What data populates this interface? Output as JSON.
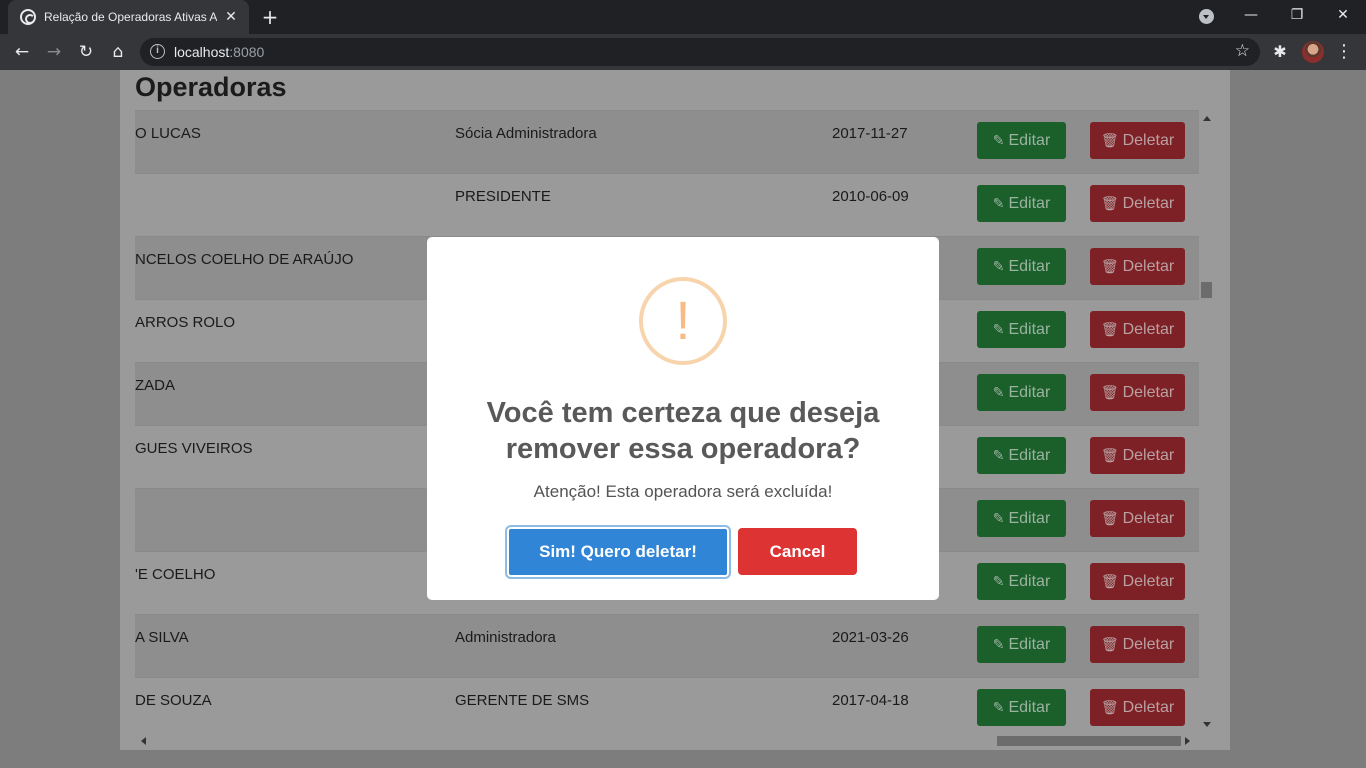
{
  "browser": {
    "tab_title": "Relação de Operadoras Ativas AN",
    "url_host": "localhost",
    "url_port": ":8080"
  },
  "page": {
    "title": "Operadoras",
    "edit_label": "Editar",
    "delete_label": "Deletar",
    "rows": [
      {
        "name": "O LUCAS",
        "role": "Sócia Administradora",
        "date": "2017-11-27"
      },
      {
        "name": "",
        "role": "PRESIDENTE",
        "date": "2010-06-09"
      },
      {
        "name": "NCELOS COELHO DE ARAÚJO",
        "role": "",
        "date": ""
      },
      {
        "name": "ARROS ROLO",
        "role": "",
        "date": ""
      },
      {
        "name": "ZADA",
        "role": "",
        "date": ""
      },
      {
        "name": "GUES VIVEIROS",
        "role": "",
        "date": ""
      },
      {
        "name": "",
        "role": "",
        "date": ""
      },
      {
        "name": "'E COELHO",
        "role": "",
        "date": ""
      },
      {
        "name": "A SILVA",
        "role": "Administradora",
        "date": "2021-03-26"
      },
      {
        "name": "DE SOUZA",
        "role": "GERENTE DE SMS",
        "date": "2017-04-18"
      }
    ]
  },
  "modal": {
    "icon_glyph": "!",
    "title": "Você tem certeza que deseja remover essa operadora?",
    "text": "Atenção! Esta operadora será excluída!",
    "confirm_label": "Sim! Quero deletar!",
    "cancel_label": "Cancel"
  }
}
